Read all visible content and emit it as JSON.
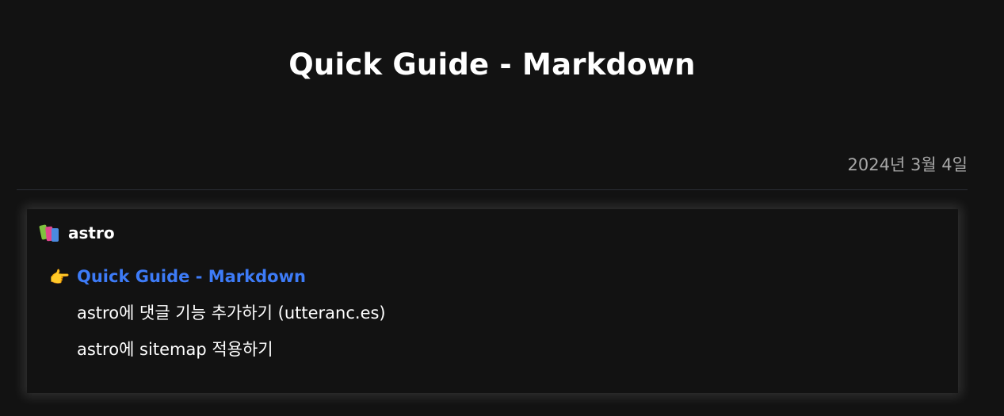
{
  "post": {
    "title": "Quick Guide - Markdown",
    "date": "2024년 3월 4일"
  },
  "series": {
    "icon": "books-icon",
    "name": "astro",
    "current_icon": "pointing-right-hand-icon",
    "items": [
      {
        "label": "Quick Guide - Markdown",
        "active": true
      },
      {
        "label": "astro에 댓글 기능 추가하기 (utteranc.es)",
        "active": false
      },
      {
        "label": "astro에 sitemap 적용하기",
        "active": false
      }
    ]
  },
  "colors": {
    "background": "#121212",
    "active_link": "#3d7bf7",
    "date_text": "#a7a7a7",
    "divider": "#2b2d36"
  }
}
